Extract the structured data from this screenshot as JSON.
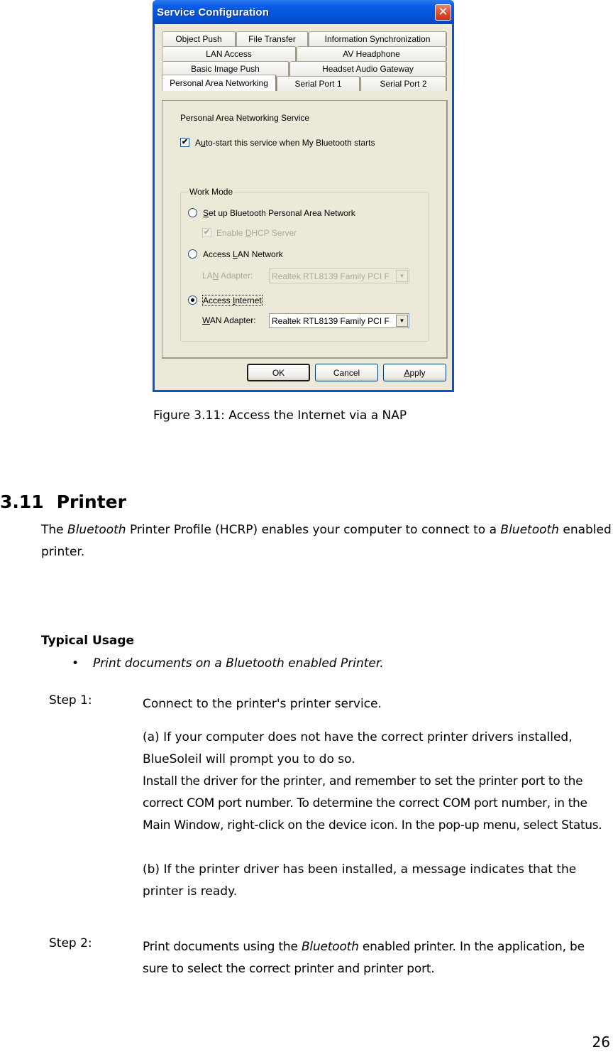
{
  "dialog": {
    "title": "Service Configuration",
    "close_label": "✕",
    "tab_rows": [
      [
        "Object Push",
        "File Transfer",
        "Information Synchronization"
      ],
      [
        "LAN Access",
        "AV Headphone"
      ],
      [
        "Basic Image Push",
        "Headset Audio Gateway"
      ],
      [
        "Personal Area Networking",
        "Serial Port 1",
        "Serial Port 2"
      ]
    ],
    "active_tab": "Personal Area Networking",
    "service_heading": "Personal Area Networking Service",
    "autostart": {
      "prefix": "A",
      "mnemonic": "u",
      "rest": "to-start this service when My Bluetooth starts",
      "checked": true
    },
    "work_mode": {
      "legend": "Work Mode",
      "option_pan": {
        "mnemonic": "S",
        "rest": "et up Bluetooth Personal Area Network",
        "selected": false
      },
      "dhcp": {
        "prefix": "Enable ",
        "mnemonic": "D",
        "rest": "HCP Server",
        "checked": true,
        "enabled": false
      },
      "option_lan": {
        "prefix": "Access ",
        "mnemonic": "L",
        "rest": "AN Network",
        "selected": false
      },
      "lan_adapter": {
        "prefix": "LA",
        "mnemonic": "N",
        "rest": " Adapter:",
        "value": "Realtek RTL8139 Family PCI F",
        "enabled": false
      },
      "option_internet": {
        "prefix": "Access ",
        "mnemonic": "I",
        "rest": "nternet",
        "selected": true
      },
      "wan_adapter": {
        "prefix": "",
        "mnemonic": "W",
        "rest": "AN Adapter:",
        "value": "Realtek RTL8139 Family PCI F",
        "enabled": true
      }
    },
    "buttons": {
      "ok": "OK",
      "cancel": "Cancel",
      "apply_mnemonic": "A",
      "apply_rest": "pply"
    }
  },
  "document": {
    "caption": "Figure 3.11: Access the Internet via a NAP",
    "section_number": "3.11",
    "section_title": "Printer",
    "intro": {
      "part1": "The ",
      "italic1": "Bluetooth",
      "part2": " Printer Profile (HCRP) enables your computer to connect to a ",
      "italic2": "Bluetooth",
      "part3": " enabled printer."
    },
    "typical_usage_heading": "Typical Usage",
    "bullet_symbol": "•",
    "bullet": "Print documents on a Bluetooth enabled Printer.",
    "steps": [
      {
        "label": "Step 1:",
        "main": "Connect to the printer's printer service.",
        "sub_a": "(a) If your computer does not have the correct printer drivers installed, BlueSoleil will prompt you to do so.",
        "sub_a2": "Install the driver for the printer, and remember to set the printer port to the correct COM port number. To determine the correct COM port number, in the Main Window, right-click on the device icon. In the pop-up menu, select Status.",
        "sub_b": "(b) If the printer driver has been installed, a message indicates that the printer is ready."
      },
      {
        "label": "Step 2:",
        "part1": "Print documents using the ",
        "italic": "Bluetooth",
        "part2": " enabled printer. In the application, be sure to select the correct printer and printer port."
      }
    ],
    "page_number": "26"
  }
}
